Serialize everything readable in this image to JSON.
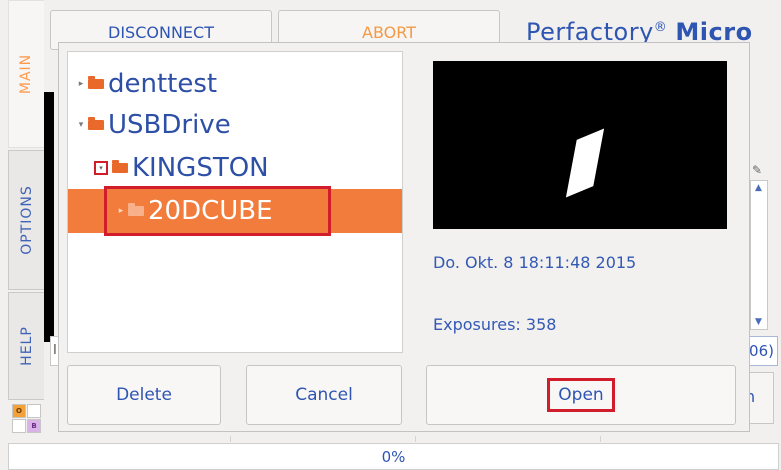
{
  "tabs": {
    "main": "MAIN",
    "options": "OPTIONS",
    "help": "HELP"
  },
  "toolbar": {
    "disconnect": "DISCONNECT",
    "abort": "ABORT"
  },
  "brand": {
    "name": "Perfactory",
    "reg": "®",
    "model": "Micro"
  },
  "background": {
    "left_field": "I",
    "right_field": "06)",
    "right_button": "n",
    "logo_o": "O",
    "logo_b": "B"
  },
  "dialog": {
    "tree": [
      {
        "label": "denttest",
        "expander": "▸"
      },
      {
        "label": "USBDrive",
        "expander": "▾"
      },
      {
        "label": "KINGSTON",
        "expander": "▾"
      },
      {
        "label": "20DCUBE",
        "expander": "▸",
        "selected": true
      }
    ],
    "preview": {
      "date": "Do. Okt. 8 18:11:48 2015",
      "exposures": "Exposures: 358"
    },
    "buttons": {
      "delete": "Delete",
      "cancel": "Cancel",
      "open": "Open"
    }
  },
  "progress": {
    "label": "0%",
    "value": 0
  },
  "colors": {
    "accent_blue": "#2e55b2",
    "accent_orange": "#f27c3c",
    "highlight_red": "#d11d2b"
  }
}
